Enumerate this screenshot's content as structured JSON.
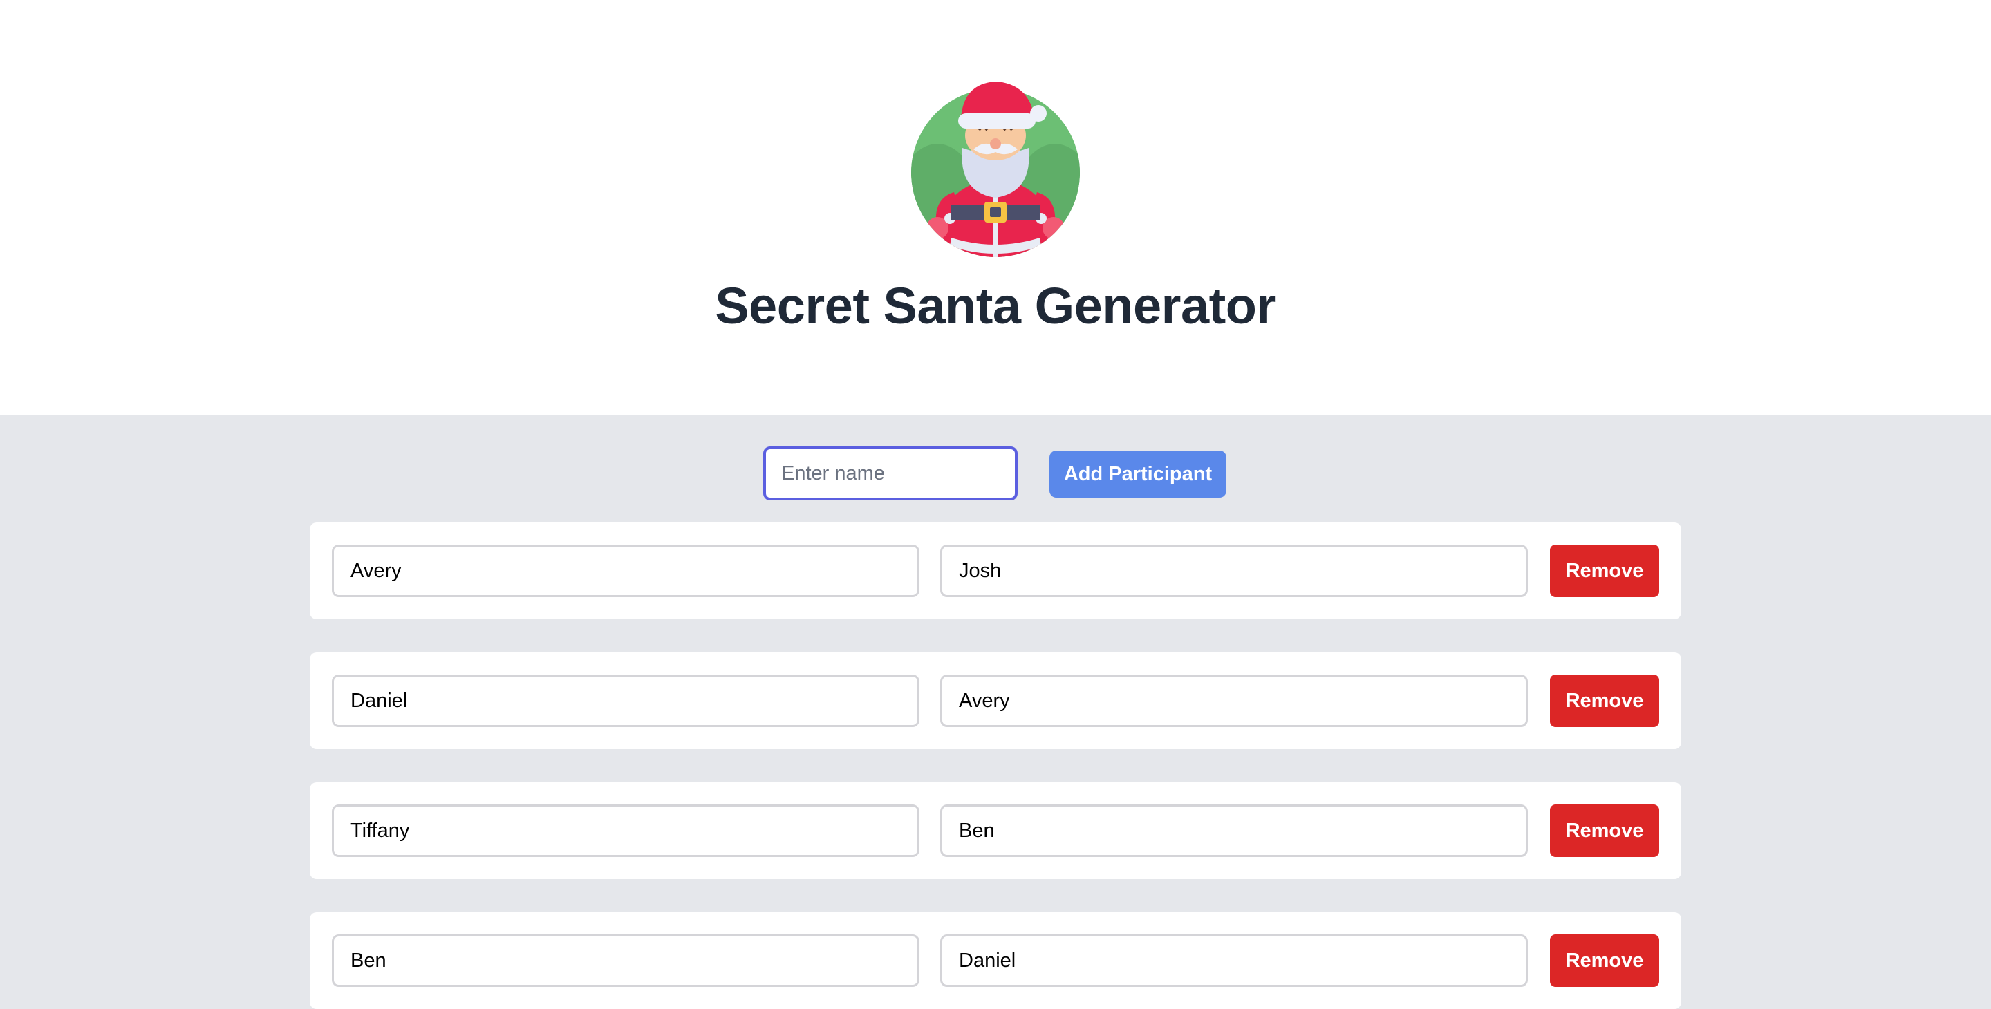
{
  "header": {
    "title": "Secret Santa Generator",
    "logo_icon": "santa-claus-icon"
  },
  "add_form": {
    "placeholder": "Enter name",
    "value": "",
    "button_label": "Add Participant"
  },
  "pairs": [
    {
      "giver": "Avery",
      "receiver": "Josh",
      "remove_label": "Remove"
    },
    {
      "giver": "Daniel",
      "receiver": "Avery",
      "remove_label": "Remove"
    },
    {
      "giver": "Tiffany",
      "receiver": "Ben",
      "remove_label": "Remove"
    },
    {
      "giver": "Ben",
      "receiver": "Daniel",
      "remove_label": "Remove"
    }
  ],
  "colors": {
    "title": "#1f2937",
    "add_button": "#5a88ea",
    "remove_button": "#dc2626",
    "focus_ring": "#5b5fe0",
    "background": "#e5e7eb"
  }
}
